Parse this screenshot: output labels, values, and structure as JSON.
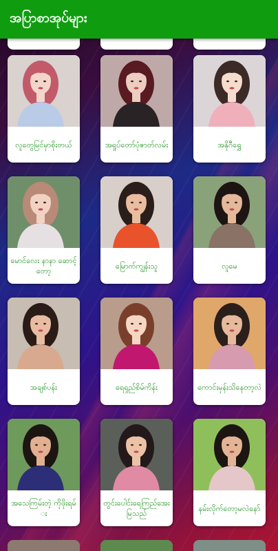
{
  "app_bar": {
    "title": "အပြာစာအုပ်များ",
    "color": "#0f9d0f"
  },
  "items": [
    {
      "label": "လူတွေမြင်မှာစိုးတယ်",
      "skin": "#f3d6c9",
      "hair": "#c25a6a",
      "top": "#b9cbe6",
      "bg": "#d9d2cf"
    },
    {
      "label": "အရှုပ်တော်ပုံဇာတ်လမ်း",
      "skin": "#eccdbf",
      "hair": "#5a1a22",
      "top": "#2a2326",
      "bg": "#bfa9a8"
    },
    {
      "label": "အနိုဂီရွှေ",
      "skin": "#f6dccd",
      "hair": "#3b2a25",
      "top": "#efb0bc",
      "bg": "#dcd5d8"
    },
    {
      "label": "မောင်လေး နာနာ ဆောင့်တော့",
      "skin": "#f2d2c2",
      "hair": "#b98a77",
      "top": "#e7e0e3",
      "bg": "#6f8f6b"
    },
    {
      "label": "မြောက်ကျွန်းသူ",
      "skin": "#e9bda0",
      "hair": "#2b1e1a",
      "top": "#e8532c",
      "bg": "#d8cfcb"
    },
    {
      "label": "လူမေ",
      "skin": "#e4b89a",
      "hair": "#1d1513",
      "top": "#8a7266",
      "bg": "#8aa27a"
    },
    {
      "label": "အချစ်ပန်း",
      "skin": "#e7bca3",
      "hair": "#2a1b17",
      "top": "#d8a98f",
      "bg": "#c7bdb2"
    },
    {
      "label": "ရေရှည်စိမ်ကိန်း",
      "skin": "#f5d6c3",
      "hair": "#7a3f2b",
      "top": "#c2176f",
      "bg": "#b99c8c"
    },
    {
      "label": "ကောင်းမှန်းသိနေတာ့လဲ",
      "skin": "#e6b99d",
      "hair": "#2b1f1b",
      "top": "#d79bb0",
      "bg": "#e0a76a"
    },
    {
      "label": "အသေကြမ်းတဲ့ ကိုဖိုးရမ်း",
      "skin": "#e1b090",
      "hair": "#1c1512",
      "top": "#2c2f78",
      "bg": "#6e9a5c"
    },
    {
      "label": "တွင်းပေါင်းရေကြည်အေးမြသည်",
      "skin": "#ecc2a7",
      "hair": "#23181a",
      "top": "#e18aa4",
      "bg": "#5b5f5a"
    },
    {
      "label": "နမ်းလိုက်တော့မလဲနော်",
      "skin": "#e3b496",
      "hair": "#1d1512",
      "top": "#e6c7c9",
      "bg": "#8fbf5a"
    }
  ]
}
